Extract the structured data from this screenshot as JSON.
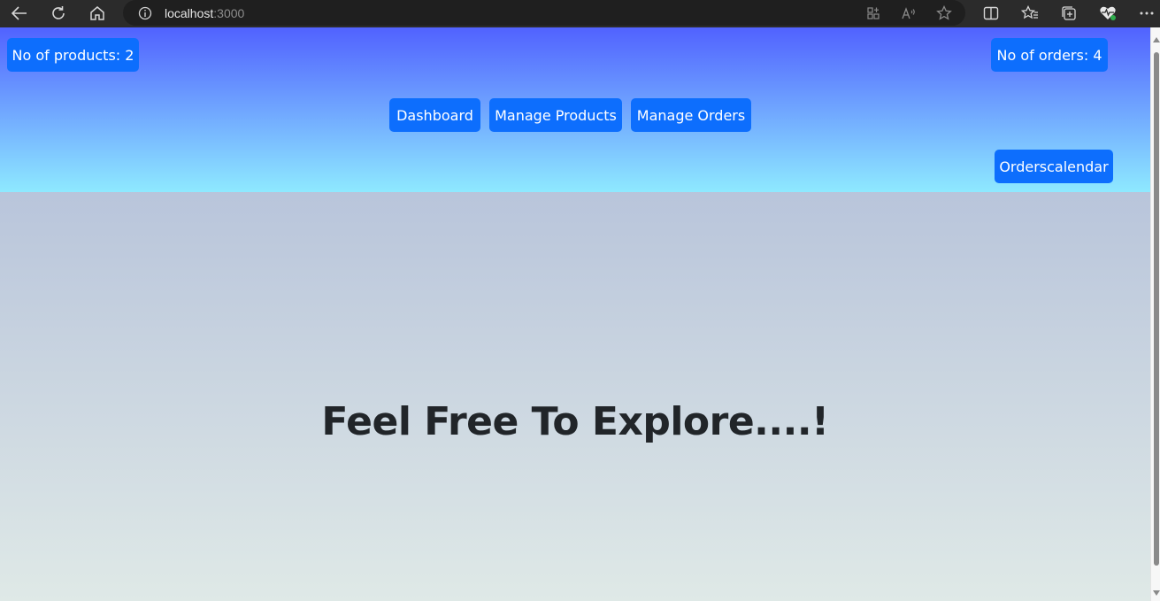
{
  "browser": {
    "url_host": "localhost",
    "url_port": ":3000",
    "icons": [
      "back-icon",
      "refresh-icon",
      "home-icon",
      "info-icon",
      "app-available-icon",
      "read-aloud-icon",
      "favorite-star-icon",
      "split-screen-icon",
      "favorites-icon",
      "collections-icon",
      "health-icon",
      "more-icon"
    ]
  },
  "header": {
    "products_count_label": "No of products: 2",
    "orders_count_label": "No of orders: 4",
    "nav": {
      "dashboard": "Dashboard",
      "manage_products": "Manage Products",
      "manage_orders": "Manage Orders"
    },
    "calendar_label": "Orderscalendar"
  },
  "main": {
    "headline": "Feel Free To Explore....!"
  },
  "colors": {
    "button": "#0d6efd",
    "header_top": "#5162ff",
    "header_bottom": "#8ee9ff",
    "body_top": "#a9b6d6",
    "body_bottom": "#dfe9e7",
    "headline": "#212529"
  }
}
